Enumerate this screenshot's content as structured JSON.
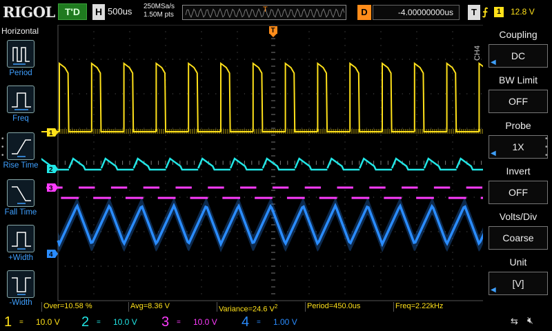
{
  "header": {
    "logo": "RIGOL",
    "run_status": "T'D",
    "timebase_letter": "H",
    "timebase": "500us",
    "sample_rate": "250MSa/s",
    "memory_depth": "1.50M pts",
    "trigger_pos_marker": "T",
    "delay_letter": "D",
    "delay_value": "-4.00000000us",
    "trigger_letter": "T",
    "trigger_edge": "⨍",
    "trigger_source": "1",
    "trigger_level": "12.8 V"
  },
  "left_menu": {
    "title": "Horizontal",
    "items": [
      {
        "label": "Period",
        "icon": "period-icon"
      },
      {
        "label": "Freq",
        "icon": "freq-icon"
      },
      {
        "label": "Rise Time",
        "icon": "rise-time-icon"
      },
      {
        "label": "Fall Time",
        "icon": "fall-time-icon"
      },
      {
        "label": "+Width",
        "icon": "pos-width-icon"
      },
      {
        "label": "-Width",
        "icon": "neg-width-icon"
      }
    ]
  },
  "right_menu": {
    "channel_tag": "CH4",
    "items": [
      {
        "title": "Coupling",
        "value": "DC",
        "has_arrow": true
      },
      {
        "title": "BW Limit",
        "value": "OFF",
        "has_arrow": false
      },
      {
        "title": "Probe",
        "value": "1X",
        "has_arrow": true
      },
      {
        "title": "Invert",
        "value": "OFF",
        "has_arrow": false
      },
      {
        "title": "Volts/Div",
        "value": "Coarse",
        "has_arrow": false
      },
      {
        "title": "Unit",
        "value": "[V]",
        "has_arrow": true
      }
    ]
  },
  "channel_markers": {
    "ch1": "1",
    "ch2": "2",
    "ch3": "3",
    "ch4": "4",
    "trigger_top": "T"
  },
  "measurements": {
    "over": "Over=10.58 %",
    "avg": "Avg=8.36 V",
    "variance_value": "Variance=24.6 V",
    "variance_sup": "2",
    "period": "Period=450.0us",
    "freq": "Freq=2.22kHz"
  },
  "channels": [
    {
      "num": "1",
      "coupling": "=",
      "scale": "10.0 V",
      "color": "#ffe11a"
    },
    {
      "num": "2",
      "coupling": "=",
      "scale": "10.0 V",
      "color": "#21e6e6"
    },
    {
      "num": "3",
      "coupling": "=",
      "scale": "10.0 V",
      "color": "#ff3cff"
    },
    {
      "num": "4",
      "coupling": "=",
      "scale": "1.00 V",
      "color": "#2a8cff"
    }
  ],
  "status_icons": [
    "usb-icon",
    "speaker-mute-icon"
  ],
  "colors": {
    "ch1": "#ffe11a",
    "ch2": "#21e6e6",
    "ch3": "#ff3cff",
    "ch4": "#2a8cff",
    "trigger": "#ff8c1a",
    "run_status_bg": "#1f7a1f"
  },
  "waveform": {
    "period_us": 450,
    "timebase_us_per_div": 500
  }
}
